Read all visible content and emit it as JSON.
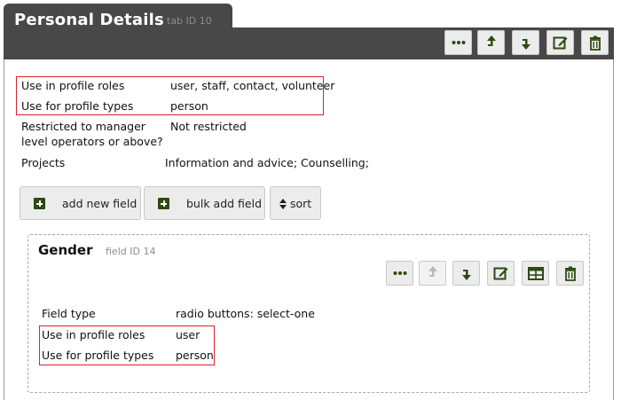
{
  "tab": {
    "title": "Personal Details",
    "id_label": "tab ID 10"
  },
  "rows": [
    {
      "label": "Use in profile roles",
      "value": "user, staff, contact, volunteer"
    },
    {
      "label": "Use for profile types",
      "value": "person"
    },
    {
      "label_line1": "Restricted to manager",
      "label_line2": "level operators or above?",
      "value": "Not restricted"
    },
    {
      "label": "Projects",
      "value": "Information and advice; Counselling;"
    }
  ],
  "buttons": {
    "add_new_field": "add new field",
    "bulk_add_field": "bulk add field",
    "sort": "sort"
  },
  "field": {
    "title": "Gender",
    "id_label": "field ID 14",
    "rows": [
      {
        "label": "Field type",
        "value": "radio buttons: select-one"
      },
      {
        "label": "Use in profile roles",
        "value": "user"
      },
      {
        "label": "Use for profile types",
        "value": "person"
      }
    ]
  },
  "colors": {
    "header_bg": "#484848",
    "button_bg": "#ececec",
    "icon_color": "#2d4a12",
    "highlight": "#d9232e"
  },
  "icons": [
    "more-icon",
    "move-up-icon",
    "move-down-icon",
    "edit-icon",
    "delete-icon",
    "table-icon",
    "plus-icon",
    "sort-icon"
  ]
}
